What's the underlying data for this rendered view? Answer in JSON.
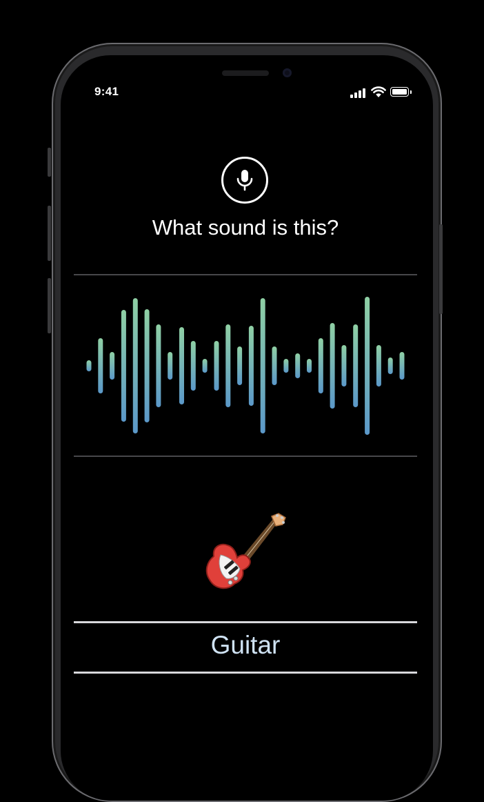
{
  "status_bar": {
    "time": "9:41",
    "signal_icon": "cellular-signal-icon",
    "wifi_icon": "wifi-icon",
    "battery_icon": "battery-icon"
  },
  "header": {
    "mic_icon": "microphone-icon",
    "prompt": "What sound is this?"
  },
  "waveform": {
    "icon": "audio-waveform",
    "gradient_top": "#8fd0a4",
    "gradient_bottom": "#5b98c9",
    "bar_levels": [
      0.08,
      0.4,
      0.2,
      0.81,
      0.98,
      0.82,
      0.6,
      0.2,
      0.56,
      0.36,
      0.1,
      0.36,
      0.6,
      0.28,
      0.58,
      0.98,
      0.28,
      0.1,
      0.18,
      0.1,
      0.4,
      0.62,
      0.3,
      0.6,
      1.0,
      0.3,
      0.12,
      0.2
    ]
  },
  "result": {
    "emoji": "🎸",
    "emoji_icon": "electric-guitar-icon",
    "label": "Guitar"
  },
  "colors": {
    "background": "#000000",
    "result_text": "#cfe2f3",
    "divider": "#48484b"
  }
}
